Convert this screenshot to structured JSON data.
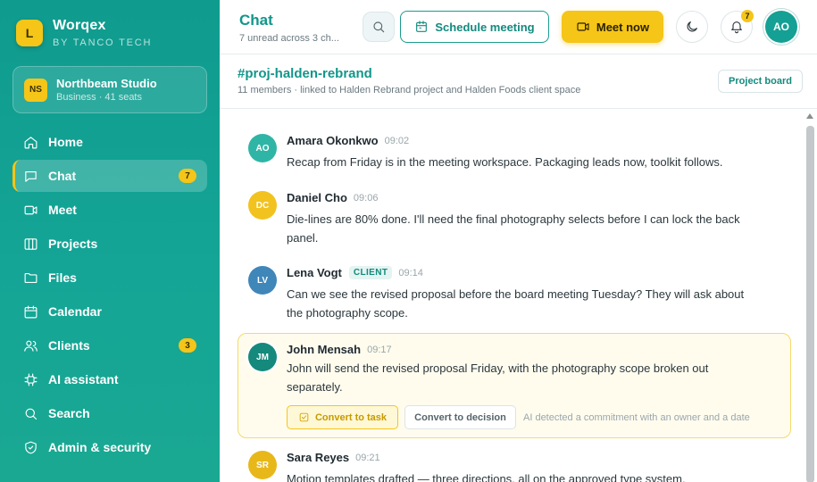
{
  "brand": {
    "logo_letter": "L",
    "name": "Worqex",
    "subtitle": "BY TANCO TECH"
  },
  "workspace": {
    "badge": "NS",
    "name": "Northbeam Studio",
    "meta": "Business · 41 seats"
  },
  "sidebar": {
    "items": [
      {
        "label": "Home",
        "icon": "home-icon",
        "active": false
      },
      {
        "label": "Chat",
        "icon": "chat-icon",
        "active": true,
        "count": "7"
      },
      {
        "label": "Meet",
        "icon": "video-icon",
        "active": false
      },
      {
        "label": "Projects",
        "icon": "board-icon",
        "active": false
      },
      {
        "label": "Files",
        "icon": "folder-icon",
        "active": false
      },
      {
        "label": "Calendar",
        "icon": "calendar-icon",
        "active": false
      },
      {
        "label": "Clients",
        "icon": "users-icon",
        "active": false,
        "count": "3"
      },
      {
        "label": "AI assistant",
        "icon": "chip-icon",
        "active": false
      },
      {
        "label": "Search",
        "icon": "search-icon",
        "active": false
      },
      {
        "label": "Admin & security",
        "icon": "shield-icon",
        "active": false
      }
    ]
  },
  "topbar": {
    "title": "Chat",
    "subtitle": "7 unread across 3 ch...",
    "schedule_label": "Schedule meeting",
    "meet_label": "Meet now",
    "notification_count": "7",
    "user_initials": "AO"
  },
  "channel": {
    "name": "#proj-halden-rebrand",
    "description": "11 members · linked to Halden Rebrand project and Halden Foods client space",
    "board_label": "Project board"
  },
  "messages": [
    {
      "initials": "AO",
      "author": "Amara Okonkwo",
      "time": "09:02",
      "text": "Recap from Friday is in the meeting workspace. Packaging leads now, toolkit follows.",
      "avatar_color": "#2fb5a6"
    },
    {
      "initials": "DC",
      "author": "Daniel Cho",
      "time": "09:06",
      "text": "Die-lines are 80% done. I'll need the final photography selects before I can lock the back panel.",
      "avatar_color": "#f2c21f"
    },
    {
      "initials": "LV",
      "author": "Lena Vogt",
      "tag": "CLIENT",
      "time": "09:14",
      "text": "Can we see the revised proposal before the board meeting Tuesday? They will ask about the photography scope.",
      "avatar_color": "#3f86b9"
    },
    {
      "initials": "JM",
      "author": "John Mensah",
      "time": "09:17",
      "text": "John will send the revised proposal Friday, with the photography scope broken out separately.",
      "avatar_color": "#14897c",
      "actions": {
        "task_label": "Convert to task",
        "decision_label": "Convert to decision",
        "ai_note": "AI detected a commitment with an owner and a date"
      }
    },
    {
      "initials": "SR",
      "author": "Sara Reyes",
      "time": "09:21",
      "text": "Motion templates drafted — three directions, all on the approved type system.",
      "avatar_color": "#e8b81a"
    }
  ],
  "colors": {
    "accent": "#12968a",
    "brand_yellow": "#f5c518",
    "sidebar": "#14a596"
  }
}
